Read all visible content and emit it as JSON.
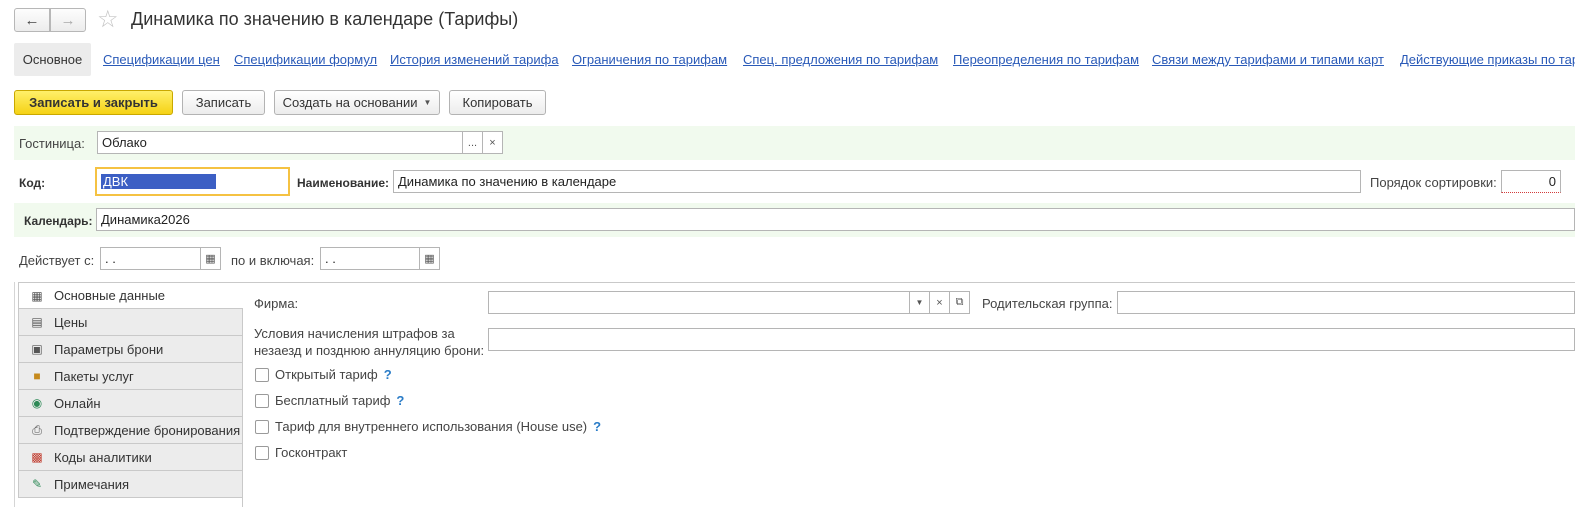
{
  "header": {
    "title": "Динамика по значению в календаре (Тарифы)",
    "back_icon": "arrow-left-icon",
    "forward_icon": "arrow-right-icon",
    "favorite_icon": "star-icon"
  },
  "sections": {
    "active": "Основное",
    "links": [
      "Спецификации цен",
      "Спецификации формул",
      "История изменений тарифа",
      "Ограничения по тарифам",
      "Спец. предложения по тарифам",
      "Переопределения по тарифам",
      "Связи между тарифами и типами карт",
      "Действующие приказы по тарифам"
    ]
  },
  "toolbar": {
    "save_close": "Записать и закрыть",
    "save": "Записать",
    "create_based": "Создать на основании",
    "copy": "Копировать"
  },
  "form": {
    "hotel_label": "Гостиница:",
    "hotel_value": "Облако",
    "code_label": "Код:",
    "code_value": "ДВК",
    "name_label": "Наименование:",
    "name_value": "Динамика по значению в календаре",
    "sort_label": "Порядок сортировки:",
    "sort_value": "0",
    "calendar_label": "Календарь:",
    "calendar_value": "Динамика2026",
    "valid_from_label": "Действует с:",
    "valid_from_value": " .  .",
    "valid_to_label": "по и включая:",
    "valid_to_value": " .  ."
  },
  "tabs": [
    {
      "label": "Основные данные",
      "icon": "table-icon"
    },
    {
      "label": "Цены",
      "icon": "cash-register-icon"
    },
    {
      "label": "Параметры брони",
      "icon": "document-icon"
    },
    {
      "label": "Пакеты услуг",
      "icon": "package-icon"
    },
    {
      "label": "Онлайн",
      "icon": "online-icon"
    },
    {
      "label": "Подтверждение бронирования",
      "icon": "printer-icon"
    },
    {
      "label": "Коды аналитики",
      "icon": "bar-chart-icon"
    },
    {
      "label": "Примечания",
      "icon": "pencil-icon"
    }
  ],
  "main": {
    "firm_label": "Фирма:",
    "firm_value": "",
    "parent_label": "Родительская группа:",
    "parent_value": "",
    "penalty_label_1": "Условия начисления штрафов за",
    "penalty_label_2": "незаезд и позднюю аннуляцию брони:",
    "penalty_value": "",
    "checkboxes": [
      {
        "label": "Открытый тариф",
        "checked": false,
        "help": "?"
      },
      {
        "label": "Бесплатный тариф",
        "checked": false,
        "help": "?"
      },
      {
        "label": "Тариф для внутреннего использования (House use)",
        "checked": false,
        "help": "?"
      },
      {
        "label": "Госконтракт",
        "checked": false,
        "help": ""
      }
    ]
  },
  "colors": {
    "accent_yellow": "#f5d215",
    "link_blue": "#2a5ab8",
    "selection_blue": "#3c5fc4",
    "band_green": "#f1faee"
  }
}
